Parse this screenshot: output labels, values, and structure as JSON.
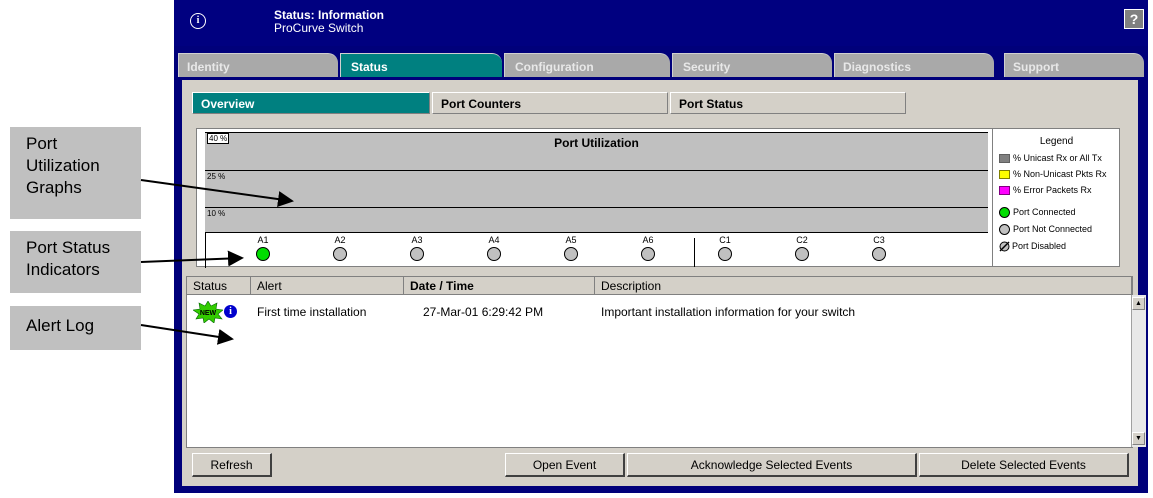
{
  "callouts": [
    {
      "lines": [
        "Port",
        "Utilization",
        "Graphs"
      ]
    },
    {
      "lines": [
        "Port Status",
        "Indicators"
      ]
    },
    {
      "lines": [
        "Alert Log"
      ]
    }
  ],
  "window": {
    "title": "Status: Information",
    "subtitle": "ProCurve Switch",
    "help": "?",
    "info_icon": "i"
  },
  "tabs": [
    "Identity",
    "Status",
    "Configuration",
    "Security",
    "Diagnostics",
    "Support"
  ],
  "active_tab": "Status",
  "subtabs": [
    "Overview",
    "Port Counters",
    "Port Status"
  ],
  "active_subtab": "Overview",
  "graph": {
    "title": "Port Utilization",
    "scale_labels": [
      "40 %",
      "25 %",
      "10 %"
    ],
    "ports": [
      {
        "name": "A1",
        "state": "connected"
      },
      {
        "name": "A2",
        "state": "not-connected"
      },
      {
        "name": "A3",
        "state": "not-connected"
      },
      {
        "name": "A4",
        "state": "not-connected"
      },
      {
        "name": "A5",
        "state": "not-connected"
      },
      {
        "name": "A6",
        "state": "not-connected"
      },
      {
        "name": "C1",
        "state": "not-connected"
      },
      {
        "name": "C2",
        "state": "not-connected"
      },
      {
        "name": "C3",
        "state": "not-connected"
      }
    ]
  },
  "legend": {
    "title": "Legend",
    "unicast": "% Unicast Rx or All Tx",
    "nonunicast": "% Non-Unicast Pkts Rx",
    "error": "% Error Packets Rx",
    "connected": "Port Connected",
    "not_connected": "Port Not Connected",
    "disabled": "Port Disabled",
    "colors": {
      "unicast": "#808080",
      "nonunicast": "#ffff00",
      "error": "#ff00ff",
      "connected": "#00dd00",
      "not_connected": "#c0c0c0"
    }
  },
  "log": {
    "columns": [
      "Status",
      "Alert",
      "Date / Time",
      "Description"
    ],
    "rows": [
      {
        "status_badge": "NEW",
        "alert": "First time installation",
        "datetime": "27-Mar-01 6:29:42 PM",
        "description": "Important installation information for your switch"
      }
    ]
  },
  "buttons": {
    "refresh": "Refresh",
    "open_event": "Open Event",
    "acknowledge": "Acknowledge Selected Events",
    "delete": "Delete Selected Events"
  }
}
